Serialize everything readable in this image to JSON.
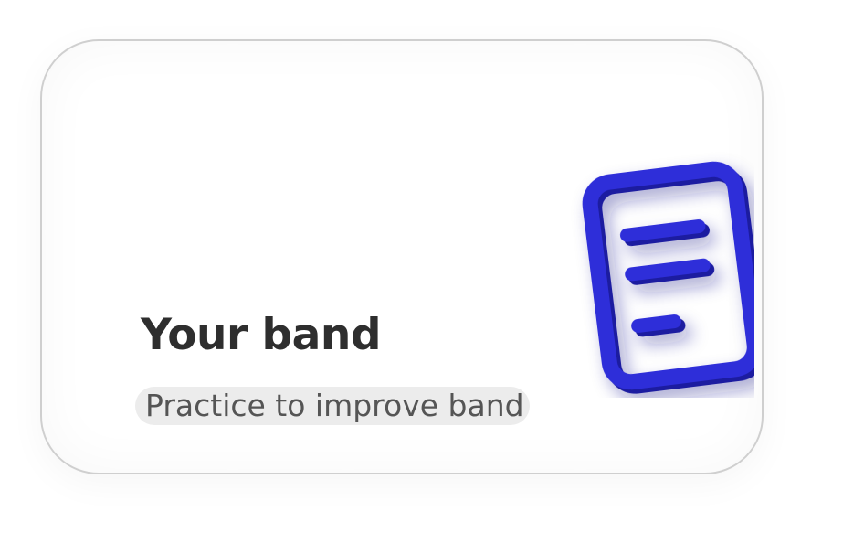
{
  "card": {
    "title": "Your band",
    "subtitle": "Practice to improve band",
    "icon": "document-icon",
    "accent_color": "#2f2fd9"
  }
}
